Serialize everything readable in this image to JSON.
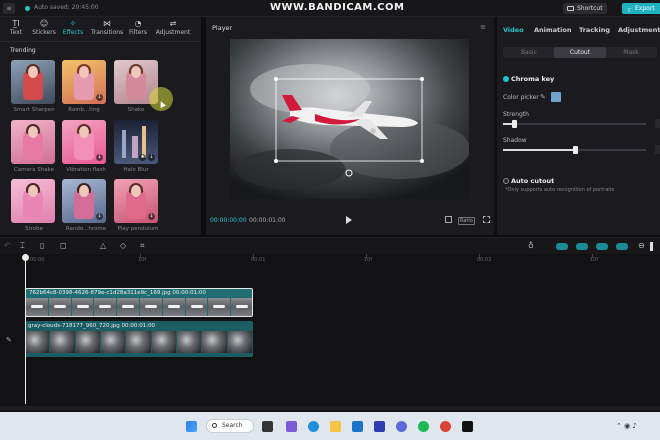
{
  "topbar": {
    "autosave": "Auto saved: 20:45:00",
    "watermark": "WWW.BANDICAM.COM",
    "shortcut_label": "Shortcut",
    "export_label": "Export"
  },
  "media_tabs": [
    {
      "label": "Text",
      "icon": "text-icon",
      "glyph": "T̲I"
    },
    {
      "label": "Stickers",
      "icon": "sticker-icon",
      "glyph": "☺"
    },
    {
      "label": "Effects",
      "icon": "effects-icon",
      "glyph": "✧"
    },
    {
      "label": "Transitions",
      "icon": "transitions-icon",
      "glyph": "⋈"
    },
    {
      "label": "Filters",
      "icon": "filters-icon",
      "glyph": "◔"
    },
    {
      "label": "Adjustment",
      "icon": "adjustment-icon",
      "glyph": "⇌"
    }
  ],
  "effects": {
    "section_title": "Trending",
    "items": [
      {
        "label": "Smart Sharpen",
        "bg": "#6a7f9a"
      },
      {
        "label": "Rainb...ting",
        "bg": "#e8a15a"
      },
      {
        "label": "Shake",
        "bg": "#c9a0a8"
      },
      {
        "label": "Camera Shake",
        "bg": "#d88ba4"
      },
      {
        "label": "Vibration flash",
        "bg": "#e86fa0"
      },
      {
        "label": "Halo Blur",
        "bg": "#2c3550"
      },
      {
        "label": "Strobe",
        "bg": "#e39ab8"
      },
      {
        "label": "Rando...hrome",
        "bg": "#7a8fb0"
      },
      {
        "label": "Play pendulum",
        "bg": "#d9738f"
      }
    ]
  },
  "player": {
    "title": "Player",
    "current_time": "00:00:00:00",
    "total_time": "00:00:01:00",
    "ratio_label": "Ratio"
  },
  "inspector": {
    "tabs": [
      "Video",
      "Animation",
      "Tracking",
      "Adjustment"
    ],
    "segments": [
      "Basic",
      "Cutout",
      "Mask"
    ],
    "chroma_key_label": "Chroma key",
    "color_picker_label": "Color picker",
    "picked_color": "#6fa3c9",
    "strength_label": "Strength",
    "strength_value": 0.08,
    "shadow_label": "Shadow",
    "shadow_value": 0.5,
    "auto_cutout_label": "Auto cutout",
    "auto_cutout_note": "*Only supports auto recognition of portraits"
  },
  "timeline": {
    "ticks": [
      "00:00",
      "10f",
      "00:01",
      "10f",
      "00:02",
      "10f"
    ],
    "clip1_label": "762b64c8-0398-4626-879e-c1d28a311e9c_169.jpg  00:00:01:00",
    "clip2_label": "gray-clouds-718177_960_720.jpg  00:00:01:00"
  },
  "taskbar": {
    "search_label": "Search"
  }
}
